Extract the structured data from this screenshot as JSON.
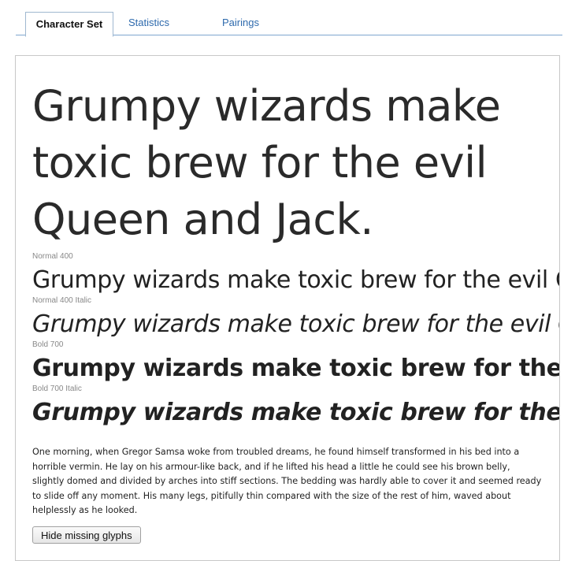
{
  "tabs": [
    {
      "label": "Character Set",
      "active": true
    },
    {
      "label": "Statistics",
      "active": false
    },
    {
      "label": "Pairings",
      "active": false
    }
  ],
  "preview": {
    "hero_text": "Grumpy wizards make toxic brew for the evil Queen and Jack.",
    "samples": [
      {
        "caption": "Normal 400",
        "text": "Grumpy wizards make toxic brew for the evil Queen and Jack."
      },
      {
        "caption": "Normal 400 Italic",
        "text": "Grumpy wizards make toxic brew for the evil Queen and Jack."
      },
      {
        "caption": "Bold 700",
        "text": "Grumpy wizards make toxic brew for the evil Queen and Jack."
      },
      {
        "caption": "Bold 700 Italic",
        "text": "Grumpy wizards make toxic brew for the evil Queen and Jack."
      }
    ],
    "paragraph": "One morning, when Gregor Samsa woke from troubled dreams, he found himself transformed in his bed into a horrible vermin. He lay on his armour-like back, and if he lifted his head a little he could see his brown belly, slightly domed and divided by arches into stiff sections. The bedding was hardly able to cover it and seemed ready to slide off any moment. His many legs, pitifully thin compared with the size of the rest of him, waved about helplessly as he looked."
  },
  "actions": {
    "hide_missing_glyphs_label": "Hide missing glyphs"
  }
}
